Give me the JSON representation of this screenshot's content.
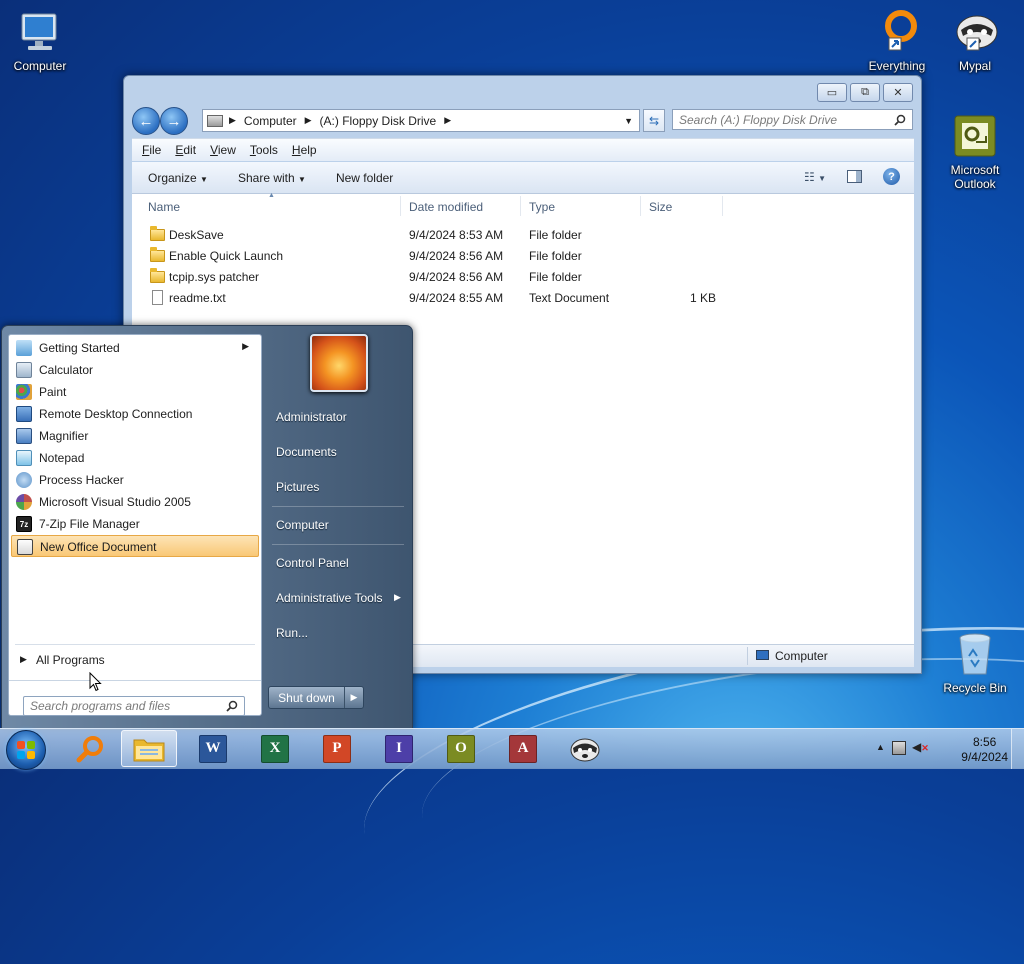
{
  "desktop": {
    "icons": [
      {
        "label": "Computer",
        "icon": "computer-icon"
      },
      {
        "label": "Everything",
        "icon": "everything-icon"
      },
      {
        "label": "Mypal",
        "icon": "mypal-icon"
      },
      {
        "label": "Microsoft Outlook",
        "icon": "outlook-icon"
      },
      {
        "label": "Recycle Bin",
        "icon": "recycle-bin-icon"
      }
    ]
  },
  "explorer": {
    "caption_buttons": {
      "minimize": "▭",
      "maximize": "⧉",
      "close": "✕"
    },
    "address": {
      "crumbs": [
        "Computer",
        "(A:) Floppy Disk Drive"
      ]
    },
    "search_placeholder": "Search (A:) Floppy Disk Drive",
    "menu": [
      "File",
      "Edit",
      "View",
      "Tools",
      "Help"
    ],
    "commands": {
      "organize": "Organize",
      "share_with": "Share with",
      "new_folder": "New folder"
    },
    "columns": {
      "name": "Name",
      "date_modified": "Date modified",
      "type": "Type",
      "size": "Size"
    },
    "files": [
      {
        "name": "DeskSave",
        "date": "9/4/2024 8:53 AM",
        "type": "File folder",
        "size": "",
        "kind": "folder"
      },
      {
        "name": "Enable Quick Launch",
        "date": "9/4/2024 8:56 AM",
        "type": "File folder",
        "size": "",
        "kind": "folder"
      },
      {
        "name": "tcpip.sys patcher",
        "date": "9/4/2024 8:56 AM",
        "type": "File folder",
        "size": "",
        "kind": "folder"
      },
      {
        "name": "readme.txt",
        "date": "9/4/2024 8:55 AM",
        "type": "Text Document",
        "size": "1 KB",
        "kind": "text"
      }
    ],
    "status_location": "Computer"
  },
  "start_menu": {
    "programs": [
      {
        "label": "Getting Started",
        "has_submenu": true,
        "color": "#5aa0d8"
      },
      {
        "label": "Calculator",
        "has_submenu": false,
        "color": "#9fb6cc"
      },
      {
        "label": "Paint",
        "has_submenu": false,
        "color": "#e1a23a"
      },
      {
        "label": "Remote Desktop Connection",
        "has_submenu": false,
        "color": "#3a70b8"
      },
      {
        "label": "Magnifier",
        "has_submenu": false,
        "color": "#4a7fc1"
      },
      {
        "label": "Notepad",
        "has_submenu": false,
        "color": "#7fc3e8"
      },
      {
        "label": "Process Hacker",
        "has_submenu": false,
        "color": "#5d93c9"
      },
      {
        "label": "Microsoft Visual Studio 2005",
        "has_submenu": false,
        "color": "#c0504d"
      },
      {
        "label": "7-Zip File Manager",
        "has_submenu": false,
        "color": "#222222"
      },
      {
        "label": "New Office Document",
        "has_submenu": false,
        "color": "#2b5797",
        "selected": true
      }
    ],
    "all_programs": "All Programs",
    "search_placeholder": "Search programs and files",
    "right_items": [
      {
        "label": "Administrator",
        "has_submenu": false
      },
      {
        "label": "Documents",
        "has_submenu": false
      },
      {
        "label": "Pictures",
        "has_submenu": false
      },
      {
        "label": "Computer",
        "has_submenu": false
      },
      {
        "label": "Control Panel",
        "has_submenu": false
      },
      {
        "label": "Administrative Tools",
        "has_submenu": true
      },
      {
        "label": "Run...",
        "has_submenu": false
      }
    ],
    "shutdown_label": "Shut down"
  },
  "taskbar": {
    "apps": [
      {
        "name": "everything",
        "icon": "search-magnifier-icon"
      },
      {
        "name": "explorer",
        "icon": "folder-icon",
        "active": true
      },
      {
        "name": "word",
        "icon": "word-icon",
        "letter": "W",
        "color": "#2b579a"
      },
      {
        "name": "excel",
        "icon": "excel-icon",
        "letter": "X",
        "color": "#217346"
      },
      {
        "name": "powerpoint",
        "icon": "powerpoint-icon",
        "letter": "P",
        "color": "#d24726"
      },
      {
        "name": "infopath",
        "icon": "infopath-icon",
        "letter": "I",
        "color": "#4d3fa8"
      },
      {
        "name": "outlook",
        "icon": "outlook-icon",
        "letter": "O",
        "color": "#7b8b22"
      },
      {
        "name": "access",
        "icon": "access-icon",
        "letter": "A",
        "color": "#a4373a"
      },
      {
        "name": "mypal",
        "icon": "mypal-icon"
      }
    ],
    "clock": {
      "time": "8:56",
      "date": "9/4/2024"
    }
  }
}
